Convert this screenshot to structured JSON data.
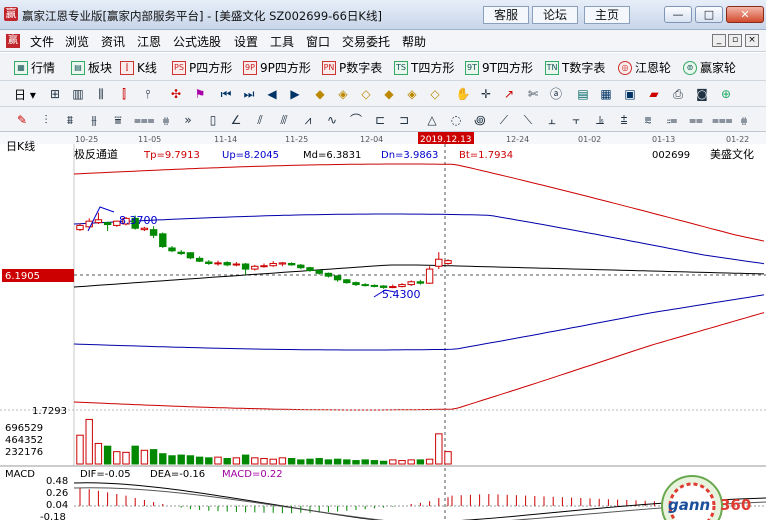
{
  "window": {
    "title": "赢家江恩专业版[赢家内部服务平台] - [美盛文化  SZ002699-66日K线]",
    "links": [
      "客服",
      "论坛",
      "主页"
    ],
    "controls": [
      "—",
      "□",
      "✕"
    ]
  },
  "menu": {
    "items": [
      "文件",
      "浏览",
      "资讯",
      "江恩",
      "公式选股",
      "设置",
      "工具",
      "窗口",
      "交易委托",
      "帮助"
    ],
    "mdi": [
      "_",
      "▫",
      "×"
    ]
  },
  "toolbar1": {
    "items": [
      {
        "label": "行情",
        "icon": "quote-grid-icon"
      },
      {
        "label": "板块",
        "icon": "sector-icon"
      },
      {
        "label": "K线",
        "icon": "candlestick-icon"
      },
      {
        "label": "P四方形",
        "icon": "p-square-icon"
      },
      {
        "label": "9P四方形",
        "icon": "9p-square-icon"
      },
      {
        "label": "P数字表",
        "icon": "p-number-table-icon"
      },
      {
        "label": "T四方形",
        "icon": "t-square-icon"
      },
      {
        "label": "9T四方形",
        "icon": "9t-square-icon"
      },
      {
        "label": "T数字表",
        "icon": "t-number-table-icon"
      },
      {
        "label": "江恩轮",
        "icon": "gann-wheel-icon"
      },
      {
        "label": "赢家轮",
        "icon": "winner-wheel-icon"
      }
    ],
    "icon_glyphs": [
      "▦",
      "▤",
      "⫿",
      "PS",
      "9P",
      "PN",
      "TS",
      "9T",
      "TN",
      "◎",
      "⊚"
    ]
  },
  "toolbar2": {
    "period_label": "日"
  },
  "chart": {
    "period_label": "日K线",
    "indicator_name": "极反通道",
    "stats": [
      {
        "label": "Tp=9.7913",
        "color": "#cc0000"
      },
      {
        "label": "Up=8.2045",
        "color": "#0000cc"
      },
      {
        "label": "Md=6.3831",
        "color": "#000000"
      },
      {
        "label": "Dn=3.9863",
        "color": "#0000cc"
      },
      {
        "label": "Bt=1.7934",
        "color": "#cc0000"
      }
    ],
    "stock_code": "002699",
    "stock_name": "美盛文化",
    "date_labels": [
      "10-25",
      "11-05",
      "11-14",
      "11-25",
      "12-04",
      "12-24",
      "01-02",
      "01-13",
      "01-22"
    ],
    "highlight_date": "2019.12.13",
    "crosshair_price": "6.1905",
    "annotations": [
      "8.3700",
      "5.4300"
    ],
    "y_label_low": "1.7293",
    "volume_labels": [
      "696529",
      "464352",
      "232176"
    ],
    "macd_panel": {
      "name": "MACD",
      "dif": "DIF=-0.05",
      "dea": "DEA=-0.16",
      "macd": "MACD=0.22",
      "y_labels": [
        "0.48",
        "0.26",
        "0.04",
        "-0.18"
      ]
    }
  },
  "chart_data": {
    "type": "candlestick",
    "title": "美盛文化 002699 日K线",
    "candles": [
      {
        "o": 8.0,
        "c": 8.15,
        "h": 8.22,
        "l": 7.95
      },
      {
        "o": 8.1,
        "c": 8.3,
        "h": 8.4,
        "l": 8.05
      },
      {
        "o": 8.25,
        "c": 8.35,
        "h": 8.6,
        "l": 8.2
      },
      {
        "o": 8.25,
        "c": 8.18,
        "h": 8.28,
        "l": 7.95
      },
      {
        "o": 8.15,
        "c": 8.3,
        "h": 8.32,
        "l": 8.1
      },
      {
        "o": 8.2,
        "c": 8.4,
        "h": 8.45,
        "l": 8.15
      },
      {
        "o": 8.4,
        "c": 8.05,
        "h": 8.5,
        "l": 8.0
      },
      {
        "o": 8.0,
        "c": 8.05,
        "h": 8.1,
        "l": 7.95
      },
      {
        "o": 8.0,
        "c": 7.8,
        "h": 8.12,
        "l": 7.7
      },
      {
        "o": 7.85,
        "c": 7.4,
        "h": 7.9,
        "l": 7.35
      },
      {
        "o": 7.35,
        "c": 7.25,
        "h": 7.42,
        "l": 7.2
      },
      {
        "o": 7.2,
        "c": 7.15,
        "h": 7.28,
        "l": 7.1
      },
      {
        "o": 7.18,
        "c": 7.0,
        "h": 7.2,
        "l": 6.95
      },
      {
        "o": 6.98,
        "c": 6.88,
        "h": 7.05,
        "l": 6.85
      },
      {
        "o": 6.85,
        "c": 6.8,
        "h": 6.92,
        "l": 6.75
      },
      {
        "o": 6.8,
        "c": 6.82,
        "h": 6.9,
        "l": 6.72
      },
      {
        "o": 6.83,
        "c": 6.75,
        "h": 6.88,
        "l": 6.7
      },
      {
        "o": 6.76,
        "c": 6.78,
        "h": 6.85,
        "l": 6.7
      },
      {
        "o": 6.78,
        "c": 6.6,
        "h": 6.82,
        "l": 6.4
      },
      {
        "o": 6.6,
        "c": 6.7,
        "h": 6.75,
        "l": 6.55
      },
      {
        "o": 6.7,
        "c": 6.72,
        "h": 6.8,
        "l": 6.65
      },
      {
        "o": 6.72,
        "c": 6.8,
        "h": 6.88,
        "l": 6.68
      },
      {
        "o": 6.78,
        "c": 6.82,
        "h": 6.85,
        "l": 6.7
      },
      {
        "o": 6.8,
        "c": 6.75,
        "h": 6.84,
        "l": 6.72
      },
      {
        "o": 6.74,
        "c": 6.65,
        "h": 6.78,
        "l": 6.6
      },
      {
        "o": 6.65,
        "c": 6.55,
        "h": 6.68,
        "l": 6.5
      },
      {
        "o": 6.55,
        "c": 6.45,
        "h": 6.58,
        "l": 6.4
      },
      {
        "o": 6.45,
        "c": 6.35,
        "h": 6.48,
        "l": 6.3
      },
      {
        "o": 6.36,
        "c": 6.22,
        "h": 6.38,
        "l": 6.15
      },
      {
        "o": 6.22,
        "c": 6.12,
        "h": 6.25,
        "l": 6.08
      },
      {
        "o": 6.12,
        "c": 6.05,
        "h": 6.16,
        "l": 6.0
      },
      {
        "o": 6.05,
        "c": 6.02,
        "h": 6.1,
        "l": 5.98
      },
      {
        "o": 6.02,
        "c": 6.0,
        "h": 6.06,
        "l": 5.95
      },
      {
        "o": 6.0,
        "c": 5.95,
        "h": 6.03,
        "l": 5.9
      },
      {
        "o": 5.96,
        "c": 5.98,
        "h": 6.05,
        "l": 5.92
      },
      {
        "o": 5.98,
        "c": 6.05,
        "h": 6.1,
        "l": 5.95
      },
      {
        "o": 6.05,
        "c": 6.15,
        "h": 6.2,
        "l": 6.0
      },
      {
        "o": 6.15,
        "c": 6.1,
        "h": 6.22,
        "l": 6.05
      },
      {
        "o": 6.1,
        "c": 6.6,
        "h": 6.7,
        "l": 6.08
      },
      {
        "o": 6.7,
        "c": 6.95,
        "h": 7.2,
        "l": 6.6
      },
      {
        "o": 6.8,
        "c": 6.9,
        "h": 6.95,
        "l": 6.75
      }
    ],
    "volume": [
      420000,
      650000,
      300000,
      260000,
      180000,
      170000,
      260000,
      200000,
      210000,
      150000,
      120000,
      130000,
      120000,
      100000,
      90000,
      100000,
      80000,
      90000,
      130000,
      90000,
      80000,
      70000,
      90000,
      80000,
      60000,
      70000,
      80000,
      60000,
      70000,
      60000,
      50000,
      60000,
      50000,
      40000,
      60000,
      50000,
      60000,
      60000,
      70000,
      440000,
      180000
    ],
    "macd": [
      0.45,
      0.42,
      0.38,
      0.34,
      0.3,
      0.26,
      0.2,
      0.15,
      0.1,
      0.05,
      0.0,
      -0.04,
      -0.08,
      -0.1,
      -0.12,
      -0.13,
      -0.14,
      -0.15,
      -0.16,
      -0.16,
      -0.17,
      -0.17,
      -0.18,
      -0.18,
      -0.17,
      -0.17,
      -0.16,
      -0.15,
      -0.14,
      -0.12,
      -0.1,
      -0.08,
      -0.06,
      -0.04,
      -0.02,
      0.0,
      0.05,
      0.08,
      0.12,
      0.2,
      0.22
    ],
    "colors": {
      "up": "#cc0000",
      "down": "#008800",
      "channel_outer": "#cc0000",
      "channel_inner": "#0000aa",
      "mid": "#000000"
    }
  }
}
